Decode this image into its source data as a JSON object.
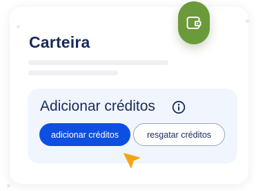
{
  "wallet": {
    "title": "Carteira",
    "badge_icon": "wallet-icon",
    "badge_color": "#6b9a3a"
  },
  "credits_section": {
    "title": "Adicionar créditos",
    "info_icon": "info-icon",
    "buttons": {
      "add_label": "adicionar créditos",
      "redeem_label": "resgatar créditos"
    }
  },
  "colors": {
    "primary_button": "#0d4fe0",
    "title_text": "#172a5a",
    "panel_background": "#f1f5fd",
    "cursor": "#f2a516"
  }
}
